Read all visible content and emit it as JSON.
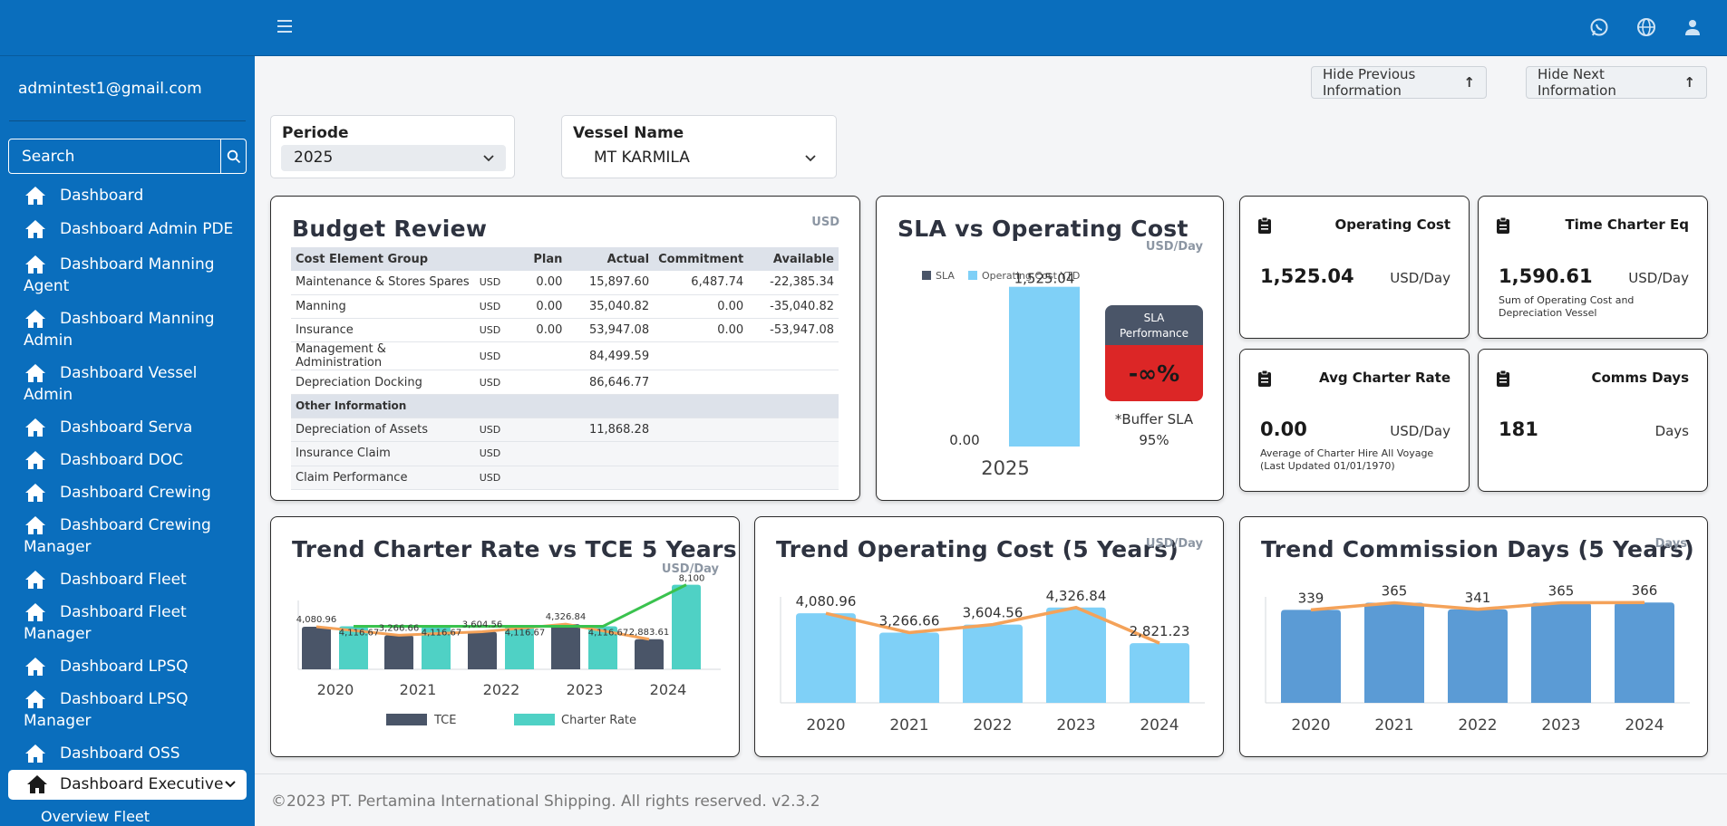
{
  "header": {
    "menu_icon": "hamburger-icon",
    "icons": [
      "whatsapp-icon",
      "globe-icon",
      "user-icon"
    ]
  },
  "sidebar": {
    "email": "admintest1@gmail.com",
    "search_placeholder": "Search",
    "items": [
      {
        "line1": "Dashboard",
        "line2": ""
      },
      {
        "line1": "Dashboard Admin PDE",
        "line2": ""
      },
      {
        "line1": "Dashboard Manning",
        "line2": "Agent"
      },
      {
        "line1": "Dashboard Manning",
        "line2": "Admin"
      },
      {
        "line1": "Dashboard Vessel",
        "line2": "Admin"
      },
      {
        "line1": "Dashboard Serva",
        "line2": ""
      },
      {
        "line1": "Dashboard DOC",
        "line2": ""
      },
      {
        "line1": "Dashboard Crewing",
        "line2": ""
      },
      {
        "line1": "Dashboard Crewing",
        "line2": "Manager"
      },
      {
        "line1": "Dashboard Fleet",
        "line2": ""
      },
      {
        "line1": "Dashboard Fleet",
        "line2": "Manager"
      },
      {
        "line1": "Dashboard LPSQ",
        "line2": ""
      },
      {
        "line1": "Dashboard LPSQ",
        "line2": "Manager"
      },
      {
        "line1": "Dashboard OSS",
        "line2": ""
      }
    ],
    "active_item": "Dashboard Executive",
    "sub_item": "Overview Fleet"
  },
  "actions": {
    "hide_previous": "Hide Previous Information",
    "hide_next": "Hide Next Information"
  },
  "filters": {
    "periode_label": "Periode",
    "periode_value": "2025",
    "vessel_label": "Vessel Name",
    "vessel_value": "MT KARMILA"
  },
  "budget": {
    "title": "Budget Review",
    "unit": "USD",
    "headers": [
      "Cost Element Group",
      "",
      "Plan",
      "Actual",
      "Commitment",
      "Available"
    ],
    "rows": [
      {
        "name": "Maintenance & Stores Spares",
        "cur": "USD",
        "plan": "0.00",
        "actual": "15,897.60",
        "commitment": "6,487.74",
        "available": "-22,385.34"
      },
      {
        "name": "Manning",
        "cur": "USD",
        "plan": "0.00",
        "actual": "35,040.82",
        "commitment": "0.00",
        "available": "-35,040.82"
      },
      {
        "name": "Insurance",
        "cur": "USD",
        "plan": "0.00",
        "actual": "53,947.08",
        "commitment": "0.00",
        "available": "-53,947.08"
      },
      {
        "name": "Management & Administration",
        "cur": "USD",
        "plan": "",
        "actual": "84,499.59",
        "commitment": "",
        "available": ""
      },
      {
        "name": "Depreciation Docking",
        "cur": "USD",
        "plan": "",
        "actual": "86,646.77",
        "commitment": "",
        "available": ""
      }
    ],
    "other_section": "Other Information",
    "other_rows": [
      {
        "name": "Depreciation of Assets",
        "cur": "USD",
        "actual": "11,868.28"
      },
      {
        "name": "Insurance Claim",
        "cur": "USD",
        "actual": ""
      },
      {
        "name": "Claim Performance",
        "cur": "USD",
        "actual": ""
      }
    ]
  },
  "sla": {
    "title": "SLA vs Operating Cost",
    "unit": "USD/Day",
    "legend": [
      "SLA",
      "Operating Cost YTD"
    ],
    "sla_value": "0.00",
    "opcost_value": "1,525.04",
    "year": "2025",
    "perf_label_1": "SLA",
    "perf_label_2": "Performance",
    "perf_value": "-∞%",
    "buffer_label": "*Buffer SLA",
    "buffer_value": "95%"
  },
  "stats": [
    {
      "title": "Operating Cost",
      "value": "1,525.04",
      "unit": "USD/Day",
      "note": ""
    },
    {
      "title": "Time Charter Eq",
      "value": "1,590.61",
      "unit": "USD/Day",
      "note": "Sum of Operating Cost and Depreciation Vessel"
    },
    {
      "title": "Avg Charter Rate",
      "value": "0.00",
      "unit": "USD/Day",
      "note": "Average of Charter Hire All Voyage (Last Updated 01/01/1970)"
    },
    {
      "title": "Comms Days",
      "value": "181",
      "unit": "Days",
      "note": ""
    }
  ],
  "trend_charter": {
    "title": "Trend Charter Rate vs TCE 5 Years",
    "unit": "USD/Day"
  },
  "trend_opcost": {
    "title": "Trend Operating Cost (5 Years)",
    "unit": "USD/Day"
  },
  "trend_comm": {
    "title": "Trend Commission Days (5 Years)",
    "unit": "Days"
  },
  "chart_data": [
    {
      "type": "bar",
      "title": "SLA vs Operating Cost",
      "categories": [
        "2025"
      ],
      "series": [
        {
          "name": "SLA",
          "values": [
            0.0
          ],
          "labels": [
            "0.00"
          ]
        },
        {
          "name": "Operating Cost YTD",
          "values": [
            1525.04
          ],
          "labels": [
            "1,525.04"
          ]
        }
      ]
    },
    {
      "type": "bar",
      "title": "Trend Charter Rate vs TCE 5 Years",
      "categories": [
        "2020",
        "2021",
        "2022",
        "2023",
        "2024"
      ],
      "series": [
        {
          "name": "TCE",
          "values": [
            4080.96,
            3266.66,
            3604.56,
            4326.84,
            2883.61
          ],
          "labels": [
            "4,080.96",
            "3,266.66",
            "3,604.56",
            "4,326.84",
            "2,883.61"
          ]
        },
        {
          "name": "Charter Rate",
          "values": [
            4116.67,
            4116.67,
            4116.67,
            4116.67,
            8100
          ],
          "labels": [
            "4,116.67",
            "4,116.67",
            "4,116.67",
            "4,116.67",
            "8,100"
          ]
        }
      ]
    },
    {
      "type": "bar",
      "title": "Trend Operating Cost (5 Years)",
      "categories": [
        "2020",
        "2021",
        "2022",
        "2023",
        "2024"
      ],
      "values": [
        4080.96,
        3266.66,
        3604.56,
        4326.84,
        2821.23
      ],
      "labels": [
        "4,080.96",
        "3,266.66",
        "3,604.56",
        "4,326.84",
        "2,821.23"
      ]
    },
    {
      "type": "bar",
      "title": "Trend Commission Days (5 Years)",
      "categories": [
        "2020",
        "2021",
        "2022",
        "2023",
        "2024"
      ],
      "values": [
        339,
        365,
        341,
        365,
        366
      ],
      "labels": [
        "339",
        "365",
        "341",
        "365",
        "366"
      ]
    }
  ],
  "footer": "©2023 PT. Pertamina International Shipping. All rights reserved. v2.3.2",
  "colors": {
    "primary": "#0a6ebd",
    "tce": "#4a5568",
    "charter": "#4fd1c5",
    "opcost": "#7fd0f7",
    "comm": "#5b9bd5",
    "line": "#f4a259",
    "line_green": "#3ac24e",
    "perf_red": "#dc2626",
    "perf_head": "#4a5568"
  }
}
